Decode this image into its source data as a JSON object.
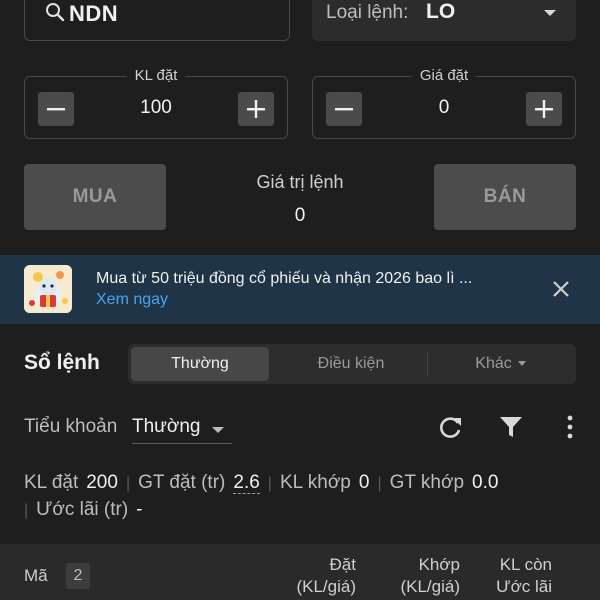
{
  "symbol": {
    "value": "NDN"
  },
  "order_type": {
    "label": "Loại lệnh:",
    "value": "LO"
  },
  "quantity": {
    "label": "KL đặt",
    "value": "100"
  },
  "price": {
    "label": "Giá đặt",
    "value": "0"
  },
  "buy_label": "MUA",
  "sell_label": "BÁN",
  "order_value": {
    "label": "Giá trị lệnh",
    "value": "0"
  },
  "promo": {
    "text": "Mua từ 50 triệu đồng cổ phiếu và nhận 2026 bao lì ...",
    "link": "Xem ngay"
  },
  "orderbook": {
    "title": "Sổ lệnh",
    "tabs": [
      {
        "label": "Thường",
        "active": true
      },
      {
        "label": "Điều kiện",
        "active": false
      },
      {
        "label": "Khác",
        "active": false
      }
    ]
  },
  "subaccount": {
    "label": "Tiểu khoản",
    "value": "Thường"
  },
  "summary": {
    "kl_dat_label": "KL đặt",
    "kl_dat": "200",
    "gt_dat_label": "GT đặt (tr)",
    "gt_dat": "2.6",
    "kl_khop_label": "KL khớp",
    "kl_khop": "0",
    "gt_khop_label": "GT khớp",
    "gt_khop": "0.0",
    "uoc_lai_label": "Ước lãi (tr)",
    "uoc_lai": "-"
  },
  "table": {
    "col_ma": "Mã",
    "count": "2",
    "col_dat_1": "Đặt",
    "col_dat_2": "(KL/giá)",
    "col_khop_1": "Khớp",
    "col_khop_2": "(KL/giá)",
    "col_klcon_1": "KL còn",
    "col_klcon_2": "Ước lãi"
  },
  "colors": {
    "accent_link": "#4aa3f0",
    "promo_bg": "#1f3547",
    "bg": "#1e1e1e"
  }
}
